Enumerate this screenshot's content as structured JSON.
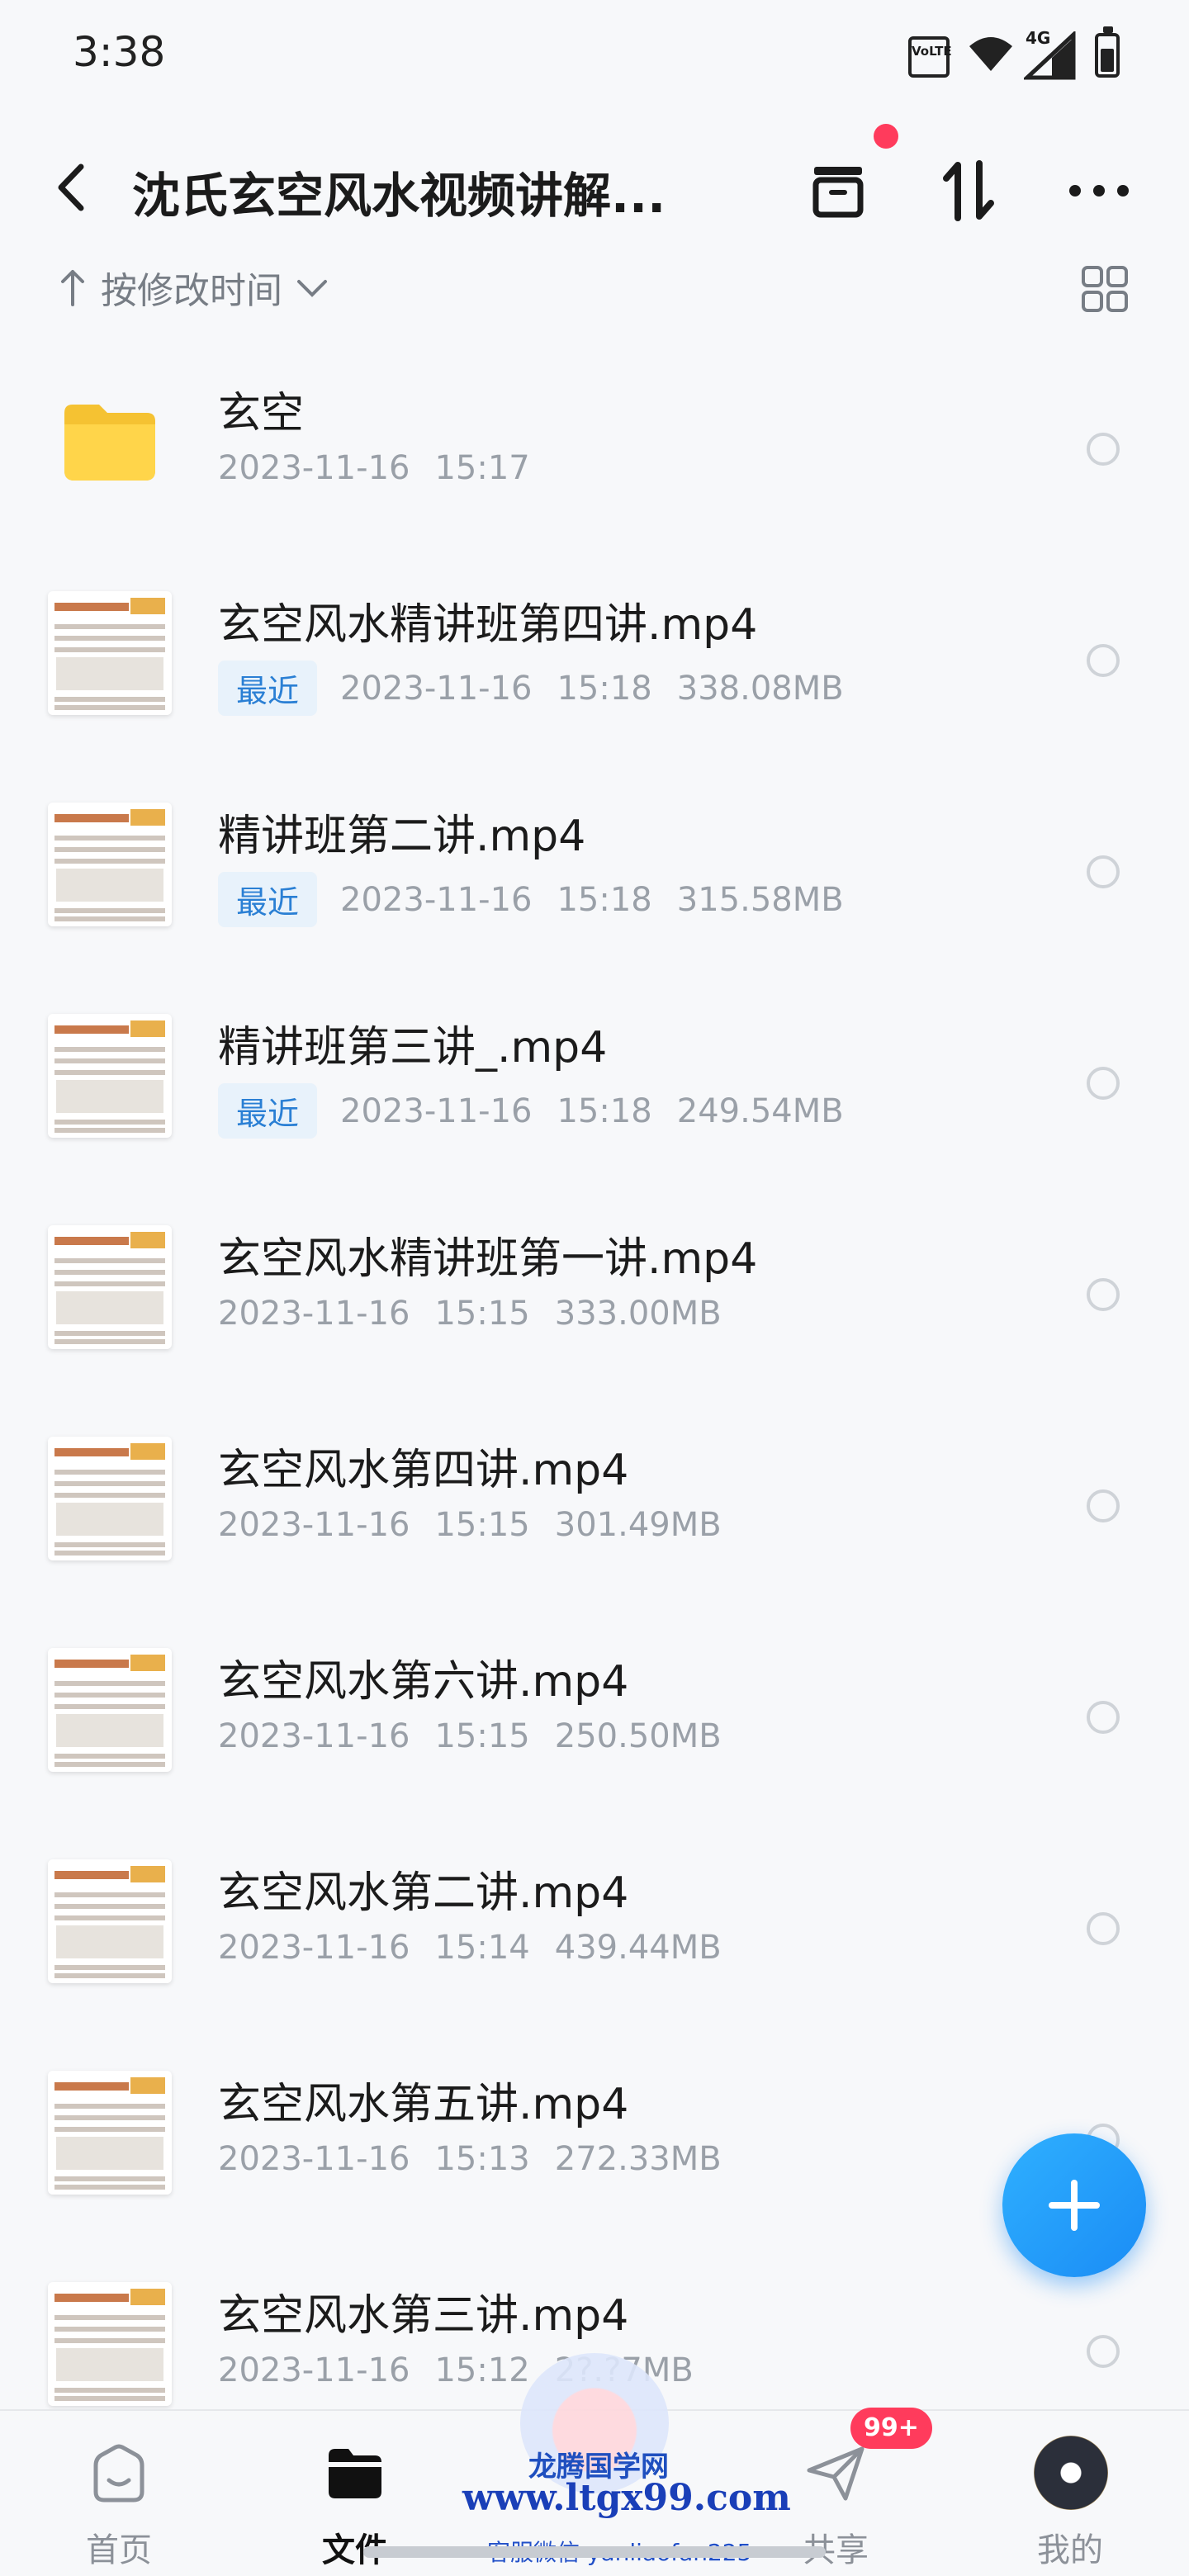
{
  "status_bar": {
    "time": "3:38",
    "volte_label": "VoLTE",
    "network_label": "4G"
  },
  "app_bar": {
    "title": "沈氏玄空风水视频讲解..."
  },
  "sort": {
    "label": "按修改时间"
  },
  "files": [
    {
      "name": "玄空",
      "type": "folder",
      "badge": "",
      "date": "2023-11-16",
      "time": "15:17",
      "size": ""
    },
    {
      "name": "玄空风水精讲班第四讲.mp4",
      "type": "video",
      "badge": "最近",
      "date": "2023-11-16",
      "time": "15:18",
      "size": "338.08MB"
    },
    {
      "name": "精讲班第二讲.mp4",
      "type": "video",
      "badge": "最近",
      "date": "2023-11-16",
      "time": "15:18",
      "size": "315.58MB"
    },
    {
      "name": "精讲班第三讲_.mp4",
      "type": "video",
      "badge": "最近",
      "date": "2023-11-16",
      "time": "15:18",
      "size": "249.54MB"
    },
    {
      "name": "玄空风水精讲班第一讲.mp4",
      "type": "video",
      "badge": "",
      "date": "2023-11-16",
      "time": "15:15",
      "size": "333.00MB"
    },
    {
      "name": "玄空风水第四讲.mp4",
      "type": "video",
      "badge": "",
      "date": "2023-11-16",
      "time": "15:15",
      "size": "301.49MB"
    },
    {
      "name": "玄空风水第六讲.mp4",
      "type": "video",
      "badge": "",
      "date": "2023-11-16",
      "time": "15:15",
      "size": "250.50MB"
    },
    {
      "name": "玄空风水第二讲.mp4",
      "type": "video",
      "badge": "",
      "date": "2023-11-16",
      "time": "15:14",
      "size": "439.44MB"
    },
    {
      "name": "玄空风水第五讲.mp4",
      "type": "video",
      "badge": "",
      "date": "2023-11-16",
      "time": "15:13",
      "size": "272.33MB"
    },
    {
      "name": "玄空风水第三讲.mp4",
      "type": "video",
      "badge": "",
      "date": "2023-11-16",
      "time": "15:12",
      "size": "2?.?7MB"
    }
  ],
  "bottom_nav": {
    "tabs": [
      {
        "label": "首页",
        "icon": "home-icon",
        "active": false
      },
      {
        "label": "文件",
        "icon": "folder-icon",
        "active": true
      },
      {
        "label": "共享",
        "icon": "send-icon",
        "active": false
      },
      {
        "label": "我的",
        "icon": "avatar-icon",
        "active": false
      }
    ],
    "share_badge": "99+"
  },
  "watermark": {
    "line1": "龙腾国学网",
    "line2": "www.ltgx99.com",
    "line3": "客服微信 yanliaofan225"
  },
  "colors": {
    "accent": "#2a7fd4",
    "fab": "#1a8cf5",
    "badge_bg": "#e8f2fb",
    "notification": "#ff3b5c",
    "folder": "#f5c232"
  }
}
